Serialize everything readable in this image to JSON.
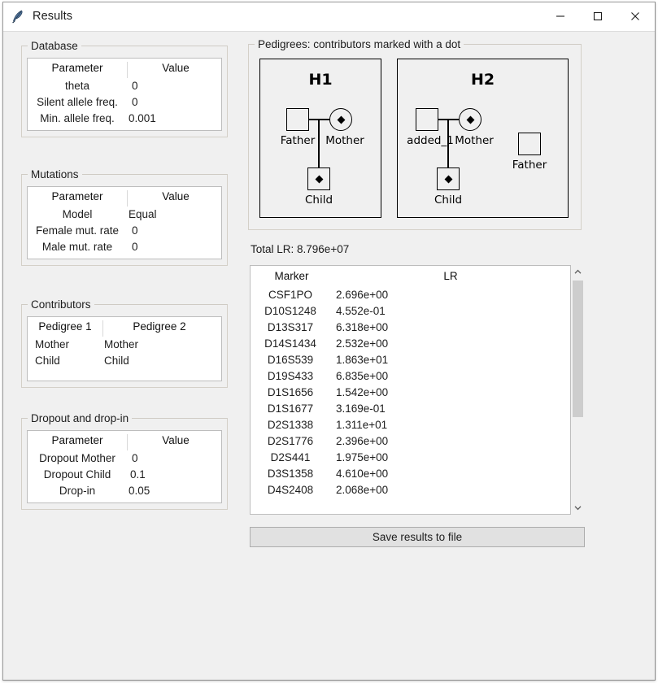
{
  "window": {
    "title": "Results",
    "icon": "feather-icon",
    "minimize_label": "—",
    "maximize_label": "□",
    "close_label": "✕"
  },
  "database": {
    "legend": "Database",
    "headers": [
      "Parameter",
      "Value"
    ],
    "rows": [
      {
        "parameter": "theta",
        "value": "0"
      },
      {
        "parameter": "Silent allele freq.",
        "value": "0"
      },
      {
        "parameter": "Min. allele freq.",
        "value": "0.001"
      }
    ]
  },
  "mutations": {
    "legend": "Mutations",
    "headers": [
      "Parameter",
      "Value"
    ],
    "rows": [
      {
        "parameter": "Model",
        "value": "Equal"
      },
      {
        "parameter": "Female mut. rate",
        "value": "0"
      },
      {
        "parameter": "Male mut. rate",
        "value": "0"
      }
    ]
  },
  "contributors": {
    "legend": "Contributors",
    "headers": [
      "Pedigree 1",
      "Pedigree 2"
    ],
    "rows": [
      {
        "pedigree1": "Mother",
        "pedigree2": "Mother"
      },
      {
        "pedigree1": "Child",
        "pedigree2": "Child"
      }
    ]
  },
  "dropout": {
    "legend": "Dropout and drop-in",
    "headers": [
      "Parameter",
      "Value"
    ],
    "rows": [
      {
        "parameter": "Dropout Mother",
        "value": "0"
      },
      {
        "parameter": "Dropout Child",
        "value": "0.1"
      },
      {
        "parameter": "Drop-in",
        "value": "0.05"
      }
    ]
  },
  "pedigrees": {
    "legend": "Pedigrees: contributors marked with a dot",
    "h1": {
      "title": "H1",
      "father_label": "Father",
      "mother_label": "Mother",
      "child_label": "Child"
    },
    "h2": {
      "title": "H2",
      "added_label": "added_1",
      "mother_label": "Mother",
      "child_label": "Child",
      "father_label": "Father"
    }
  },
  "results": {
    "total_lr_label": "Total LR: 8.796e+07",
    "headers": [
      "Marker",
      "LR"
    ],
    "rows": [
      {
        "marker": "CSF1PO",
        "lr": "2.696e+00"
      },
      {
        "marker": "D10S1248",
        "lr": "4.552e-01"
      },
      {
        "marker": "D13S317",
        "lr": "6.318e+00"
      },
      {
        "marker": "D14S1434",
        "lr": "2.532e+00"
      },
      {
        "marker": "D16S539",
        "lr": "1.863e+01"
      },
      {
        "marker": "D19S433",
        "lr": "6.835e+00"
      },
      {
        "marker": "D1S1656",
        "lr": "1.542e+00"
      },
      {
        "marker": "D1S1677",
        "lr": "3.169e-01"
      },
      {
        "marker": "D2S1338",
        "lr": "1.311e+01"
      },
      {
        "marker": "D2S1776",
        "lr": "2.396e+00"
      },
      {
        "marker": "D2S441",
        "lr": "1.975e+00"
      },
      {
        "marker": "D3S1358",
        "lr": "4.610e+00"
      },
      {
        "marker": "D4S2408",
        "lr": "2.068e+00"
      }
    ],
    "scroll_up_icon": "chevron-up-icon",
    "scroll_down_icon": "chevron-down-icon"
  },
  "save_button": {
    "label": "Save results to file"
  }
}
